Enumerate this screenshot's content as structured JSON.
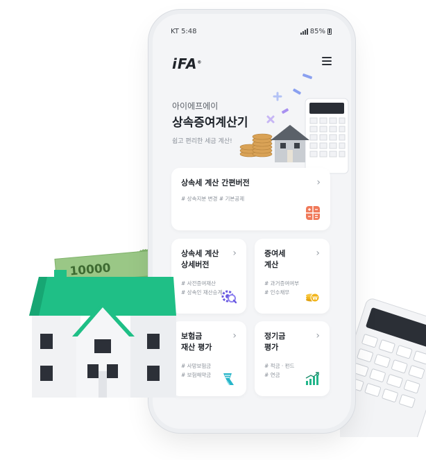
{
  "status_bar": {
    "carrier_time": "KT 5:48",
    "battery": "85%"
  },
  "header": {
    "logo": "iFA",
    "logo_mark": "®",
    "menu_icon": "hamburger-menu-icon"
  },
  "hero": {
    "subtitle": "아이에프에이",
    "title": "상속증여계산기",
    "description": "쉽고 편리한 세금 계산!"
  },
  "cards": [
    {
      "title_lines": [
        "상속세 계산 간편버전"
      ],
      "tags": [
        "# 상속지분 변경  # 기본공제"
      ],
      "icon": "calculator-icon",
      "icon_color": "#f07a5a"
    },
    {
      "title_lines": [
        "상속세 계산",
        "상세버전"
      ],
      "tags": [
        "# 사전증여재산",
        "# 상속인 재산승계"
      ],
      "icon": "gear-search-icon",
      "icon_color": "#6a5ae0"
    },
    {
      "title_lines": [
        "증여세",
        "계산"
      ],
      "tags": [
        "# 과거증여여부",
        "# 인수채무"
      ],
      "icon": "coins-icon",
      "icon_color": "#f2b51c"
    },
    {
      "title_lines": [
        "보험금",
        "재산 평가"
      ],
      "tags": [
        "# 사망보험금",
        "# 보험해약금"
      ],
      "icon": "insurance-hand-icon",
      "icon_color": "#27b5c9"
    },
    {
      "title_lines": [
        "정기금",
        "평가"
      ],
      "tags": [
        "# 적금 · 펀드",
        "# 연금"
      ],
      "icon": "growth-chart-icon",
      "icon_color": "#22b58a"
    }
  ],
  "colors": {
    "house_roof": "#1fbf86",
    "house_wall": "#f1f2f4",
    "money_green": "#9fd08a",
    "background": "#ffffff"
  }
}
